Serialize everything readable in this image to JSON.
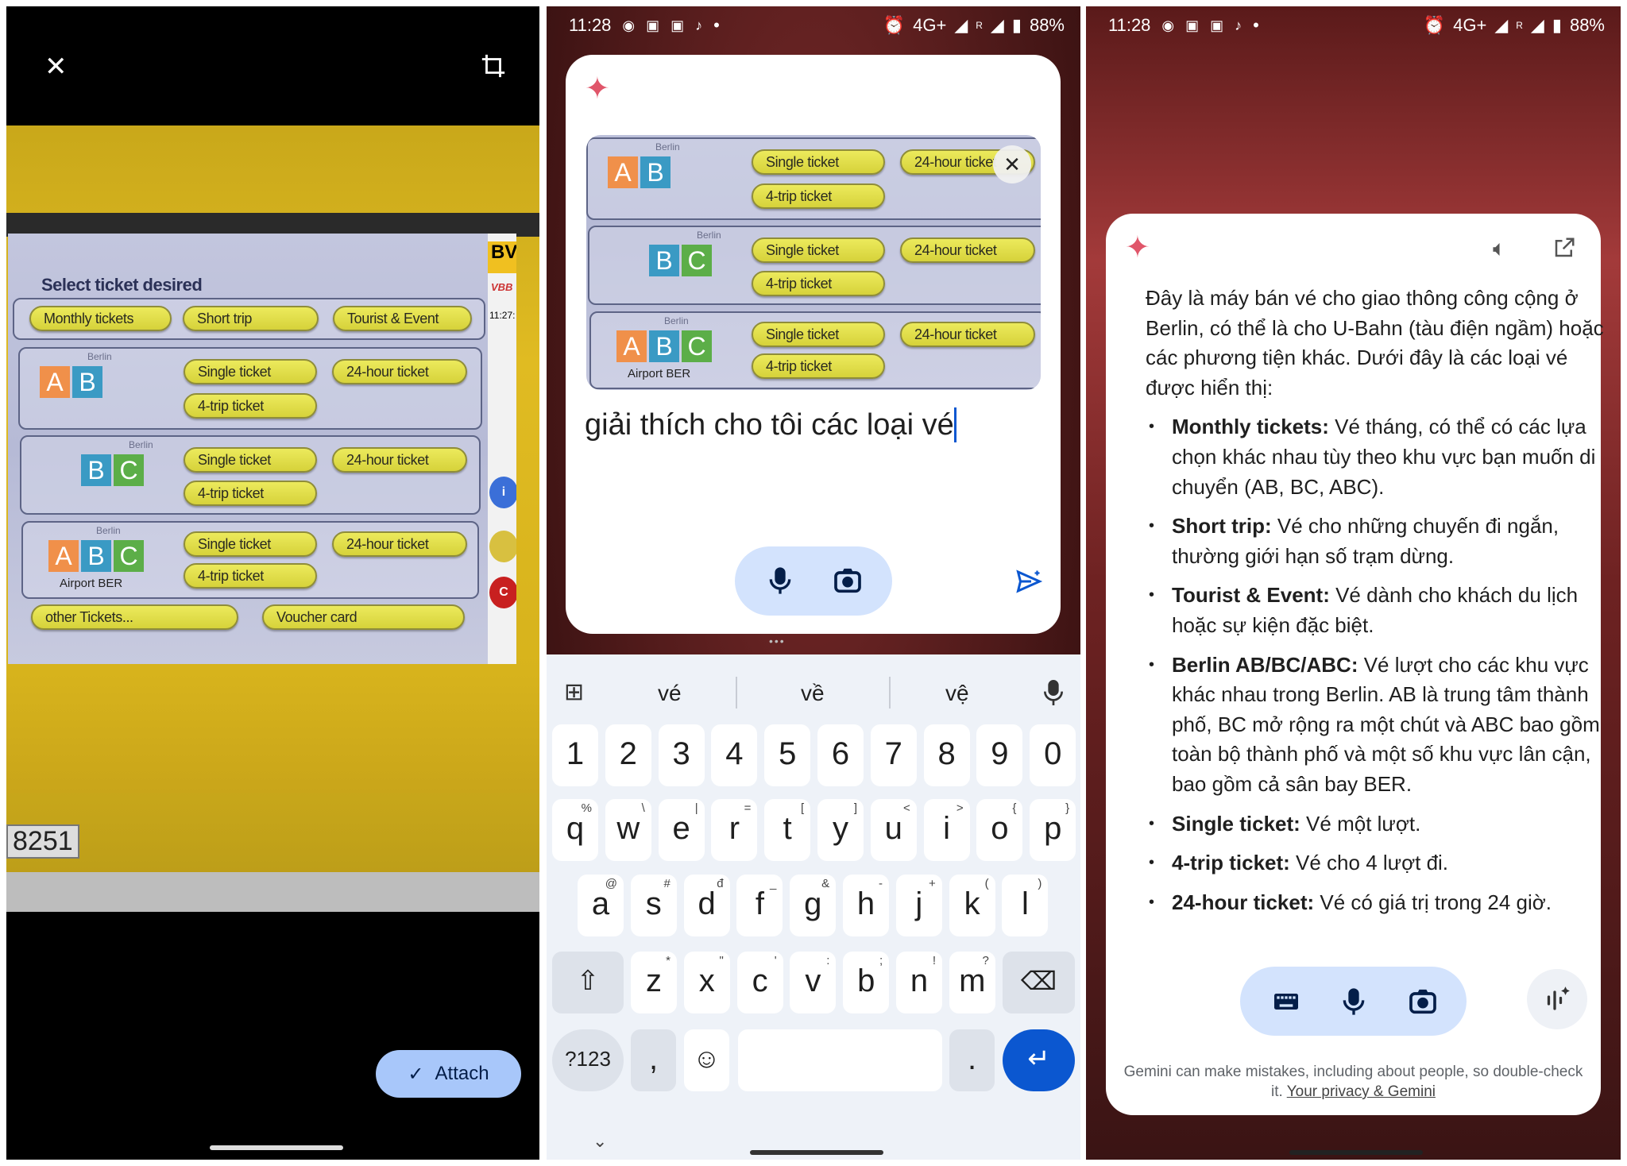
{
  "status": {
    "time": "11:28",
    "network": "4G+",
    "roaming": "R",
    "battery": "88%"
  },
  "photo_editor": {
    "attach_label": "Attach",
    "close_icon": "close-icon",
    "crop_icon": "crop-icon",
    "plate": "8251"
  },
  "machine": {
    "title": "Select ticket desired",
    "top_buttons": [
      "Monthly tickets",
      "Short trip",
      "Tourist & Event"
    ],
    "berlin": "Berlin",
    "zones": [
      {
        "letters": [
          "A",
          "B"
        ],
        "buttons": [
          "Single ticket",
          "24-hour ticket",
          "4-trip ticket"
        ]
      },
      {
        "letters": [
          "B",
          "C"
        ],
        "buttons": [
          "Single ticket",
          "24-hour ticket",
          "4-trip ticket"
        ]
      },
      {
        "letters": [
          "A",
          "B",
          "C"
        ],
        "buttons": [
          "Single ticket",
          "24-hour ticket",
          "4-trip ticket"
        ],
        "airport": "Airport BER"
      }
    ],
    "bottom_buttons": [
      "other Tickets...",
      "Voucher card"
    ],
    "side": {
      "brand": "BV",
      "logo": "VBB",
      "clock": "11:27:"
    },
    "zone_colors": {
      "A": "#f0904a",
      "B": "#3a9ac4",
      "C": "#5cae48"
    }
  },
  "compose": {
    "prompt": "giải thích cho tôi các loại vé",
    "mic_icon": "mic-icon",
    "camera_icon": "camera-icon",
    "send_icon": "send-icon"
  },
  "keyboard": {
    "suggestions": [
      "vé",
      "về",
      "vệ"
    ],
    "numbers": [
      "1",
      "2",
      "3",
      "4",
      "5",
      "6",
      "7",
      "8",
      "9",
      "0"
    ],
    "row1": [
      [
        "q",
        "%"
      ],
      [
        "w",
        "\\"
      ],
      [
        "e",
        "|"
      ],
      [
        "r",
        "="
      ],
      [
        "t",
        "["
      ],
      [
        "y",
        "]"
      ],
      [
        "u",
        "<"
      ],
      [
        "i",
        ">"
      ],
      [
        "o",
        "{"
      ],
      [
        "p",
        "}"
      ]
    ],
    "row2": [
      [
        "a",
        "@"
      ],
      [
        "s",
        "#"
      ],
      [
        "d",
        "đ"
      ],
      [
        "f",
        "_"
      ],
      [
        "g",
        "&"
      ],
      [
        "h",
        "-"
      ],
      [
        "j",
        "+"
      ],
      [
        "k",
        "("
      ],
      [
        "l",
        ")"
      ]
    ],
    "row3": [
      [
        "z",
        "*"
      ],
      [
        "x",
        "\""
      ],
      [
        "c",
        "'"
      ],
      [
        "v",
        ":"
      ],
      [
        "b",
        ";"
      ],
      [
        "n",
        "!"
      ],
      [
        "m",
        "?"
      ]
    ],
    "symbols_label": "?123",
    "comma": ",",
    "period": "."
  },
  "response": {
    "intro": "Đây là máy bán vé cho giao thông công cộng ở Berlin, có thể là cho U-Bahn (tàu điện ngầm) hoặc các phương tiện khác. Dưới đây là các loại vé được hiển thị:",
    "items": [
      {
        "term": "Monthly tickets:",
        "desc": " Vé tháng, có thể có các lựa chọn khác nhau tùy theo khu vực bạn muốn di chuyển (AB, BC, ABC)."
      },
      {
        "term": "Short trip:",
        "desc": " Vé cho những chuyến đi ngắn, thường giới hạn số trạm dừng."
      },
      {
        "term": "Tourist & Event:",
        "desc": " Vé dành cho khách du lịch hoặc sự kiện đặc biệt."
      },
      {
        "term": "Berlin AB/BC/ABC:",
        "desc": " Vé lượt cho các khu vực khác nhau trong Berlin. AB là trung tâm thành phố, BC mở rộng ra một chút và ABC bao gồm toàn bộ thành phố và một số khu vực lân cận, bao gồm cả sân bay BER."
      },
      {
        "term": "Single ticket:",
        "desc": " Vé một lượt."
      },
      {
        "term": "4-trip ticket:",
        "desc": " Vé cho 4 lượt đi."
      },
      {
        "term": "24-hour ticket:",
        "desc": " Vé có giá trị trong 24 giờ."
      }
    ],
    "disclaimer": "Gemini can make mistakes, including about people, so double-check it.",
    "privacy_link": "Your privacy & Gemini"
  },
  "colors": {
    "accent": "#0b57d0",
    "pill": "#d3e3fd",
    "gemini_star": "#e0566a"
  }
}
